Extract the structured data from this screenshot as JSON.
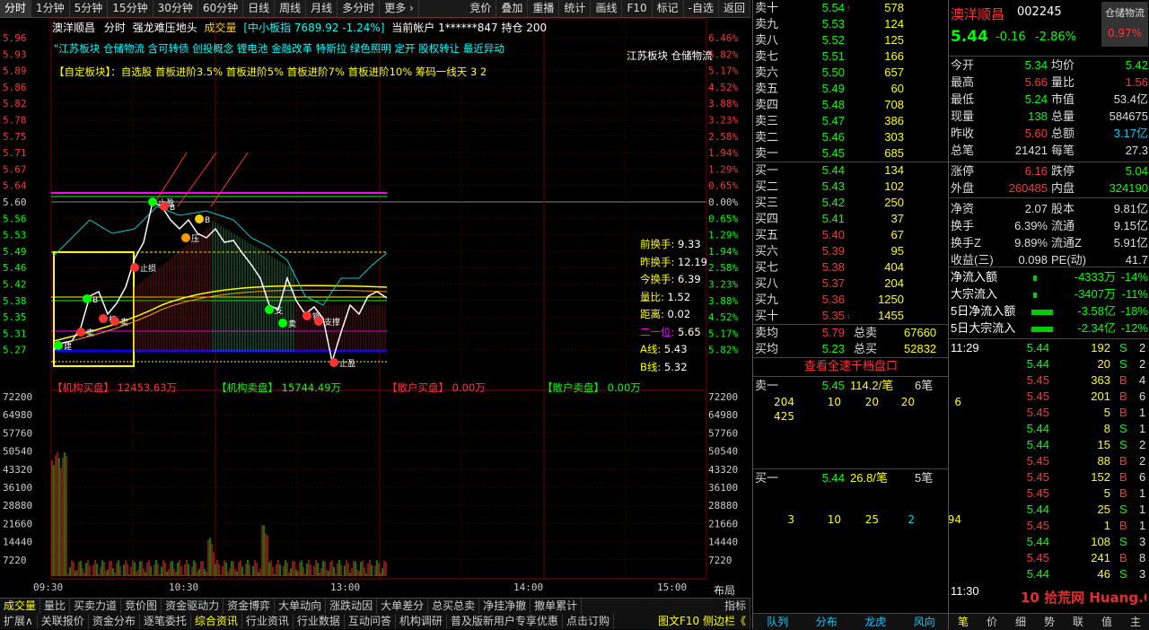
{
  "topbar": {
    "tabs": [
      "分时",
      "1分钟",
      "5分钟",
      "15分钟",
      "30分钟",
      "60分钟",
      "日线",
      "周线",
      "月线",
      "多分时",
      "更多 ›"
    ],
    "right": [
      "竞价",
      "叠加",
      "重播",
      "统计",
      "画线",
      "F10",
      "标记",
      "-自选",
      "返回"
    ]
  },
  "chart": {
    "name": "澳洋顺昌",
    "mode": "分时",
    "signal": "强龙难压地头",
    "indicator": "成交量",
    "index_info": "[中小板指 7689.92 -1.24%]",
    "account": "当前帐户 1******847  持仓 200",
    "sector_line": "\"江苏板块 仓储物流 含可转债 创投概念 锂电池 金融改革 特斯拉 绿色照明 定开 股权转让 最近异动",
    "custom_line": "【自定板块】：自选股 首板进阶3.5% 首板进阶5% 首板进阶7% 首板进阶10% 筹码一线天 3 2",
    "overlay_tag1": "江苏板块",
    "overlay_tag2": "仓储物流",
    "left_axis": [
      "5.96",
      "5.93",
      "5.89",
      "5.86",
      "5.82",
      "5.78",
      "5.75",
      "5.71",
      "5.67",
      "5.64",
      "5.60",
      "5.56",
      "5.53",
      "5.49",
      "5.46",
      "5.42",
      "5.38",
      "5.35",
      "5.31",
      "5.27"
    ],
    "right_axis": [
      "6.46%",
      "5.82%",
      "5.17%",
      "4.52%",
      "3.88%",
      "3.23%",
      "2.58%",
      "1.94%",
      "1.29%",
      "0.65%",
      "0.00%",
      "0.65%",
      "1.29%",
      "1.94%",
      "2.58%",
      "3.23%",
      "3.88%",
      "4.52%",
      "5.17%",
      "5.82%"
    ],
    "vol_axis": [
      "72200",
      "64980",
      "57760",
      "50540",
      "43320",
      "36100",
      "28880",
      "21660",
      "14440",
      "7220"
    ],
    "time_axis": [
      "09:30",
      "10:30",
      "13:00",
      "14:00",
      "15:00"
    ],
    "side_stats": [
      {
        "label": "前换手:",
        "value": "9.33"
      },
      {
        "label": "昨换手:",
        "value": "12.19"
      },
      {
        "label": "今换手:",
        "value": "6.39"
      },
      {
        "label": "量比:",
        "value": "1.52"
      },
      {
        "label": "距离:",
        "value": "0.02"
      },
      {
        "label": "二一位:",
        "value": "5.65"
      },
      {
        "label": "A线:",
        "value": "5.43"
      },
      {
        "label": "B线:",
        "value": "5.32"
      }
    ],
    "flows": [
      {
        "label": "【机构买盘】",
        "value": "12453.63万",
        "color": "#f33"
      },
      {
        "label": "【机构卖盘】",
        "value": "15744.49万",
        "color": "#0f0"
      },
      {
        "label": "【散户买盘】",
        "value": "0.00万",
        "color": "#f33"
      },
      {
        "label": "【散户卖盘】",
        "value": "0.00万",
        "color": "#0f0"
      }
    ],
    "markers": [
      "建",
      "卖",
      "机",
      "卖",
      "止损",
      "止盈",
      "B",
      "B",
      "压",
      "支",
      "卖",
      "钢",
      "支撑",
      "止盈",
      "B"
    ],
    "menu_label": "布局"
  },
  "tabs1": [
    "成交量",
    "量比",
    "买卖力道",
    "竞价图",
    "资金驱动力",
    "资金博弈",
    "大单动向",
    "涨跌动因",
    "大单差分",
    "总买总卖",
    "净挂净撤",
    "撤单累计"
  ],
  "tabs1_right": "指标",
  "tabs2": [
    "扩展∧",
    "关联报价",
    "资金分布",
    "逐笔委托",
    "综合资讯",
    "行业资讯",
    "行业数据",
    "互动问答",
    "机构调研",
    "普及版新用户专享优惠",
    "点击订购"
  ],
  "tabs2_right": "图文F10 侧边栏《",
  "book": {
    "asks": [
      {
        "label": "卖十",
        "price": "5.54",
        "vol": "578",
        "flag": "↑"
      },
      {
        "label": "卖九",
        "price": "5.53",
        "vol": "124"
      },
      {
        "label": "卖八",
        "price": "5.52",
        "vol": "125"
      },
      {
        "label": "卖七",
        "price": "5.51",
        "vol": "166"
      },
      {
        "label": "卖六",
        "price": "5.50",
        "vol": "657"
      },
      {
        "label": "卖五",
        "price": "5.49",
        "vol": "60"
      },
      {
        "label": "卖四",
        "price": "5.48",
        "vol": "708"
      },
      {
        "label": "卖三",
        "price": "5.47",
        "vol": "386"
      },
      {
        "label": "卖二",
        "price": "5.46",
        "vol": "303"
      },
      {
        "label": "卖一",
        "price": "5.45",
        "vol": "685"
      }
    ],
    "bids": [
      {
        "label": "买一",
        "price": "5.44",
        "vol": "134"
      },
      {
        "label": "买二",
        "price": "5.43",
        "vol": "102"
      },
      {
        "label": "买三",
        "price": "5.42",
        "vol": "250"
      },
      {
        "label": "买四",
        "price": "5.41",
        "vol": "37"
      },
      {
        "label": "买五",
        "price": "5.40",
        "vol": "67"
      },
      {
        "label": "买六",
        "price": "5.39",
        "vol": "95"
      },
      {
        "label": "买七",
        "price": "5.38",
        "vol": "404"
      },
      {
        "label": "买八",
        "price": "5.37",
        "vol": "204"
      },
      {
        "label": "买九",
        "price": "5.36",
        "vol": "1250"
      },
      {
        "label": "买十",
        "price": "5.35",
        "vol": "1455",
        "flag": "↓"
      }
    ],
    "avg_sell_label": "卖均",
    "avg_sell": "5.79",
    "total_sell_label": "总卖",
    "total_sell": "67660",
    "avg_buy_label": "买均",
    "avg_buy": "5.23",
    "total_buy_label": "总买",
    "total_buy": "52832",
    "full_depth": "查看全速千档盘口",
    "sell1_row": {
      "label": "卖一",
      "price": "5.45",
      "amt": "114.2/笔",
      "count": "6笔"
    },
    "sell1_queue": [
      "204",
      "10",
      "20",
      "20",
      "6",
      "425"
    ],
    "buy1_row": {
      "label": "买一",
      "price": "5.44",
      "amt": "26.8/笔",
      "count": "5笔"
    },
    "buy1_queue": [
      "3",
      "10",
      "25",
      "2",
      "94"
    ],
    "bottom_tabs": [
      "队列",
      "分布",
      "龙虎",
      "风向"
    ]
  },
  "rp": {
    "name": "澳洋顺昌",
    "code": "002245",
    "tag": "仓储物流",
    "price": "5.44",
    "change": "-0.16",
    "pct": "-2.86%",
    "tag_pct": "0.97%",
    "quote": [
      [
        "今开",
        "5.34",
        "均价",
        "5.42"
      ],
      [
        "最高",
        "5.66",
        "量比",
        "1.56"
      ],
      [
        "最低",
        "5.24",
        "市值",
        "53.4亿"
      ],
      [
        "现量",
        "138",
        "总量",
        "584675"
      ],
      [
        "昨收",
        "5.60",
        "总额",
        "3.17亿"
      ],
      [
        "总笔",
        "21421",
        "每笔",
        "27.3"
      ],
      [
        "涨停",
        "6.16",
        "跌停",
        "5.04"
      ],
      [
        "外盘",
        "260485",
        "内盘",
        "324190"
      ],
      [
        "净资",
        "2.07",
        "股本",
        "9.81亿"
      ],
      [
        "换手",
        "6.39%",
        "流通",
        "9.15亿"
      ],
      [
        "换手Z",
        "9.89%",
        "流通Z",
        "5.91亿"
      ],
      [
        "收益(三)",
        "0.098",
        "PE(动)",
        "41.7"
      ]
    ],
    "flows": [
      {
        "label": "净流入额",
        "value": "-4333万",
        "pct": "-14%"
      },
      {
        "label": "大宗流入",
        "value": "-3407万",
        "pct": "-11%"
      },
      {
        "label": "5日净流入额",
        "value": "-3.58亿",
        "pct": "-18%"
      },
      {
        "label": "5日大宗流入",
        "value": "-2.34亿",
        "pct": "-12%"
      }
    ],
    "tick_time": "11:29",
    "ticks": [
      {
        "p": "5.44",
        "v": "192",
        "s": "S",
        "n": "2"
      },
      {
        "p": "5.44",
        "v": "20",
        "s": "S",
        "n": "2"
      },
      {
        "p": "5.45",
        "v": "363",
        "s": "B",
        "n": "4"
      },
      {
        "p": "5.45",
        "v": "201",
        "s": "B",
        "n": "6"
      },
      {
        "p": "5.45",
        "v": "5",
        "s": "B",
        "n": "1"
      },
      {
        "p": "5.44",
        "v": "8",
        "s": "S",
        "n": "1"
      },
      {
        "p": "5.44",
        "v": "15",
        "s": "S",
        "n": "2"
      },
      {
        "p": "5.45",
        "v": "88",
        "s": "B",
        "n": "2"
      },
      {
        "p": "5.45",
        "v": "152",
        "s": "B",
        "n": "6"
      },
      {
        "p": "5.45",
        "v": "5",
        "s": "B",
        "n": "1"
      },
      {
        "p": "5.44",
        "v": "25",
        "s": "S",
        "n": "1"
      },
      {
        "p": "5.45",
        "v": "1",
        "s": "B",
        "n": "1"
      },
      {
        "p": "5.44",
        "v": "108",
        "s": "S",
        "n": "3"
      },
      {
        "p": "5.45",
        "v": "241",
        "s": "B",
        "n": "8"
      },
      {
        "p": "5.44",
        "v": "46",
        "s": "S",
        "n": "3"
      }
    ],
    "tick_time2": "11:30",
    "bottom_tabs": [
      "笔",
      "价",
      "细",
      "势",
      "联",
      "值",
      "主"
    ],
    "watermark": "10 拾荒网 Huang.CN"
  }
}
